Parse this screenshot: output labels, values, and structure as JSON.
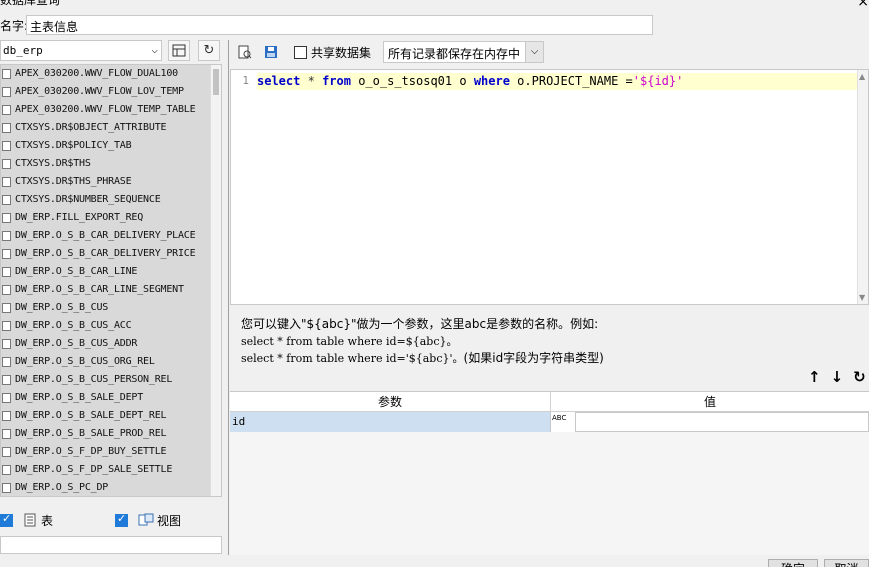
{
  "window": {
    "title": "数据库查询",
    "close_glyph": "×"
  },
  "name_field": {
    "label": "名字:",
    "value": "主表信息"
  },
  "left": {
    "db_select_value": "db_erp",
    "tables": [
      "APEX_030200.WWV_FLOW_DUAL100",
      "APEX_030200.WWV_FLOW_LOV_TEMP",
      "APEX_030200.WWV_FLOW_TEMP_TABLE",
      "CTXSYS.DR$OBJECT_ATTRIBUTE",
      "CTXSYS.DR$POLICY_TAB",
      "CTXSYS.DR$THS",
      "CTXSYS.DR$THS_PHRASE",
      "CTXSYS.DR$NUMBER_SEQUENCE",
      "DW_ERP.FILL_EXPORT_REQ",
      "DW_ERP.O_S_B_CAR_DELIVERY_PLACE",
      "DW_ERP.O_S_B_CAR_DELIVERY_PRICE",
      "DW_ERP.O_S_B_CAR_LINE",
      "DW_ERP.O_S_B_CAR_LINE_SEGMENT",
      "DW_ERP.O_S_B_CUS",
      "DW_ERP.O_S_B_CUS_ACC",
      "DW_ERP.O_S_B_CUS_ADDR",
      "DW_ERP.O_S_B_CUS_ORG_REL",
      "DW_ERP.O_S_B_CUS_PERSON_REL",
      "DW_ERP.O_S_B_SALE_DEPT",
      "DW_ERP.O_S_B_SALE_DEPT_REL",
      "DW_ERP.O_S_B_SALE_PROD_REL",
      "DW_ERP.O_S_F_DP_BUY_SETTLE",
      "DW_ERP.O_S_F_DP_SALE_SETTLE",
      "DW_ERP.O_S_PC_DP"
    ],
    "filter_table_label": "表",
    "filter_view_label": "视图",
    "filter_table_checked": true,
    "filter_view_checked": true
  },
  "toolbar": {
    "share_label": "共享数据集",
    "share_checked": false,
    "mode_value": "所有记录都保存在内存中"
  },
  "editor": {
    "line_number": "1",
    "sql": {
      "select": "select",
      "star": "*",
      "from": "from",
      "table": "o_o_s_tsosq01 o",
      "where": "where",
      "cond": "o.PROJECT_NAME =",
      "param": "'${id}'"
    }
  },
  "hint": {
    "line1": "您可以键入\"${abc}\"做为一个参数，这里abc是参数的名称。例如:",
    "line2": "select * from table where id=${abc}。",
    "line3a": "select * from table where id='${abc}'。",
    "line3b": "(如果id字段为字符串类型)"
  },
  "params": {
    "col_name": "参数",
    "col_value": "值",
    "rows": [
      {
        "name": "id",
        "type_glyph": "ABC",
        "value": ""
      }
    ]
  },
  "footer": {
    "ok": "确定",
    "cancel": "取消"
  },
  "colors": {
    "accent": "#1f7ad8",
    "selected_row": "#cddff0",
    "keyword": "#0000cc",
    "string": "#cc00cc",
    "current_line": "#ffffd0"
  }
}
